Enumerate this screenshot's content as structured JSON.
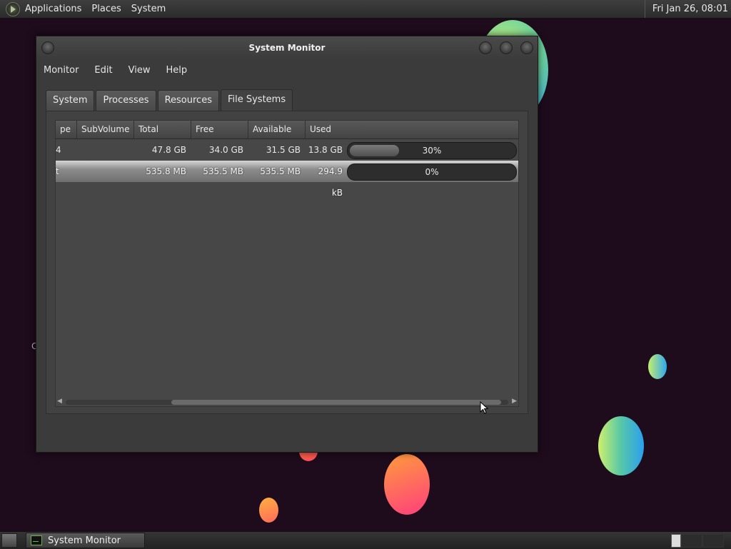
{
  "top_panel": {
    "menus": [
      "Applications",
      "Places",
      "System"
    ],
    "clock": "Fri Jan 26, 08:01"
  },
  "window": {
    "title": "System Monitor",
    "menubar": [
      "Monitor",
      "Edit",
      "View",
      "Help"
    ],
    "tabs": [
      {
        "label": "System",
        "active": false
      },
      {
        "label": "Processes",
        "active": false
      },
      {
        "label": "Resources",
        "active": false
      },
      {
        "label": "File Systems",
        "active": true
      }
    ],
    "filesystems": {
      "columns": [
        "pe",
        "SubVolume",
        "Total",
        "Free",
        "Available",
        "Used"
      ],
      "rows": [
        {
          "type": "4",
          "subvolume": "",
          "total": "47.8 GB",
          "free": "34.0 GB",
          "available": "31.5 GB",
          "used": "13.8 GB",
          "used_percent": "30%",
          "used_fraction": 0.3,
          "selected": false
        },
        {
          "type": "t",
          "subvolume": "",
          "total": "535.8 MB",
          "free": "535.5 MB",
          "available": "535.5 MB",
          "used": "294.9 kB",
          "used_percent": "0%",
          "used_fraction": 0.0,
          "selected": true
        }
      ]
    }
  },
  "desktop": {
    "letter": "C"
  },
  "taskbar": {
    "tasks": [
      {
        "label": "System Monitor"
      }
    ]
  }
}
